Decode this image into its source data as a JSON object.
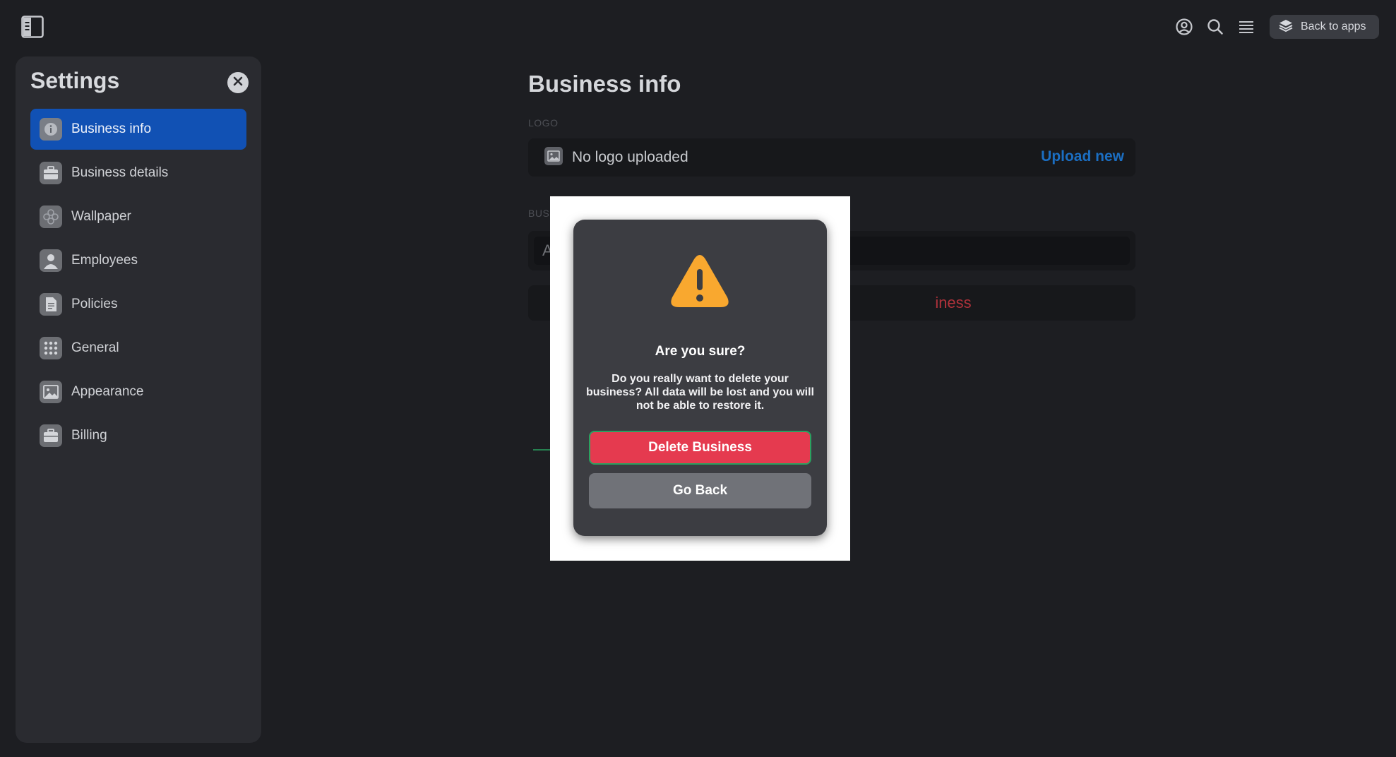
{
  "topbar": {
    "back_to_apps_label": "Back to apps"
  },
  "settings": {
    "title": "Settings",
    "items": [
      {
        "label": "Business info",
        "icon": "info-icon",
        "active": true
      },
      {
        "label": "Business details",
        "icon": "briefcase-icon",
        "active": false
      },
      {
        "label": "Wallpaper",
        "icon": "flower-icon",
        "active": false
      },
      {
        "label": "Employees",
        "icon": "person-icon",
        "active": false
      },
      {
        "label": "Policies",
        "icon": "document-icon",
        "active": false
      },
      {
        "label": "General",
        "icon": "grid-icon",
        "active": false
      },
      {
        "label": "Appearance",
        "icon": "image-icon",
        "active": false
      },
      {
        "label": "Billing",
        "icon": "briefcase-icon",
        "active": false
      }
    ]
  },
  "main": {
    "title": "Business info",
    "logo_label": "LOGO",
    "logo_status": "No logo uploaded",
    "upload_label": "Upload new",
    "business_label_partial": "BUSI",
    "business_name_partial": "A",
    "delete_partial": "iness"
  },
  "modal": {
    "title": "Are you sure?",
    "message": "Do you really want to delete your business? All data will be lost and you will not be able to restore it.",
    "delete_label": "Delete Business",
    "back_label": "Go Back"
  },
  "colors": {
    "background": "#1d1e22",
    "active_nav": "#1151b4",
    "danger": "#e53a4f",
    "warning": "#f9a82f",
    "link": "#1b6ec2"
  }
}
